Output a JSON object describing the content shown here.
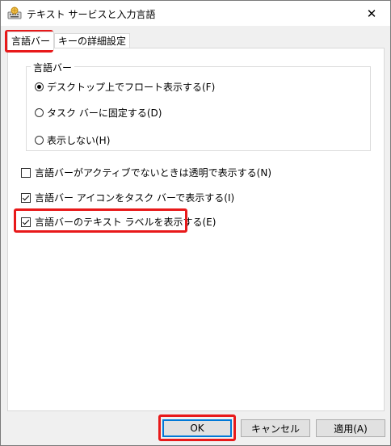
{
  "window": {
    "title": "テキスト サービスと入力言語",
    "icon": "keyboard-globe-icon",
    "close_glyph": "✕"
  },
  "tabs": [
    {
      "label": "言語バー",
      "active": true
    },
    {
      "label": "キーの詳細設定",
      "active": false
    }
  ],
  "language_bar_group": {
    "legend": "言語バー",
    "options": [
      {
        "label": "デスクトップ上でフロート表示する(F)",
        "selected": true
      },
      {
        "label": "タスク バーに固定する(D)",
        "selected": false
      },
      {
        "label": "表示しない(H)",
        "selected": false
      }
    ]
  },
  "checkboxes": [
    {
      "label": "言語バーがアクティブでないときは透明で表示する(N)",
      "checked": false
    },
    {
      "label": "言語バー アイコンをタスク バーで表示する(I)",
      "checked": true
    },
    {
      "label": "言語バーのテキスト ラベルを表示する(E)",
      "checked": true
    }
  ],
  "buttons": {
    "ok": "OK",
    "cancel": "キャンセル",
    "apply": "適用(A)"
  },
  "colors": {
    "highlight": "#e8191a",
    "default_button_border": "#0078d7"
  }
}
